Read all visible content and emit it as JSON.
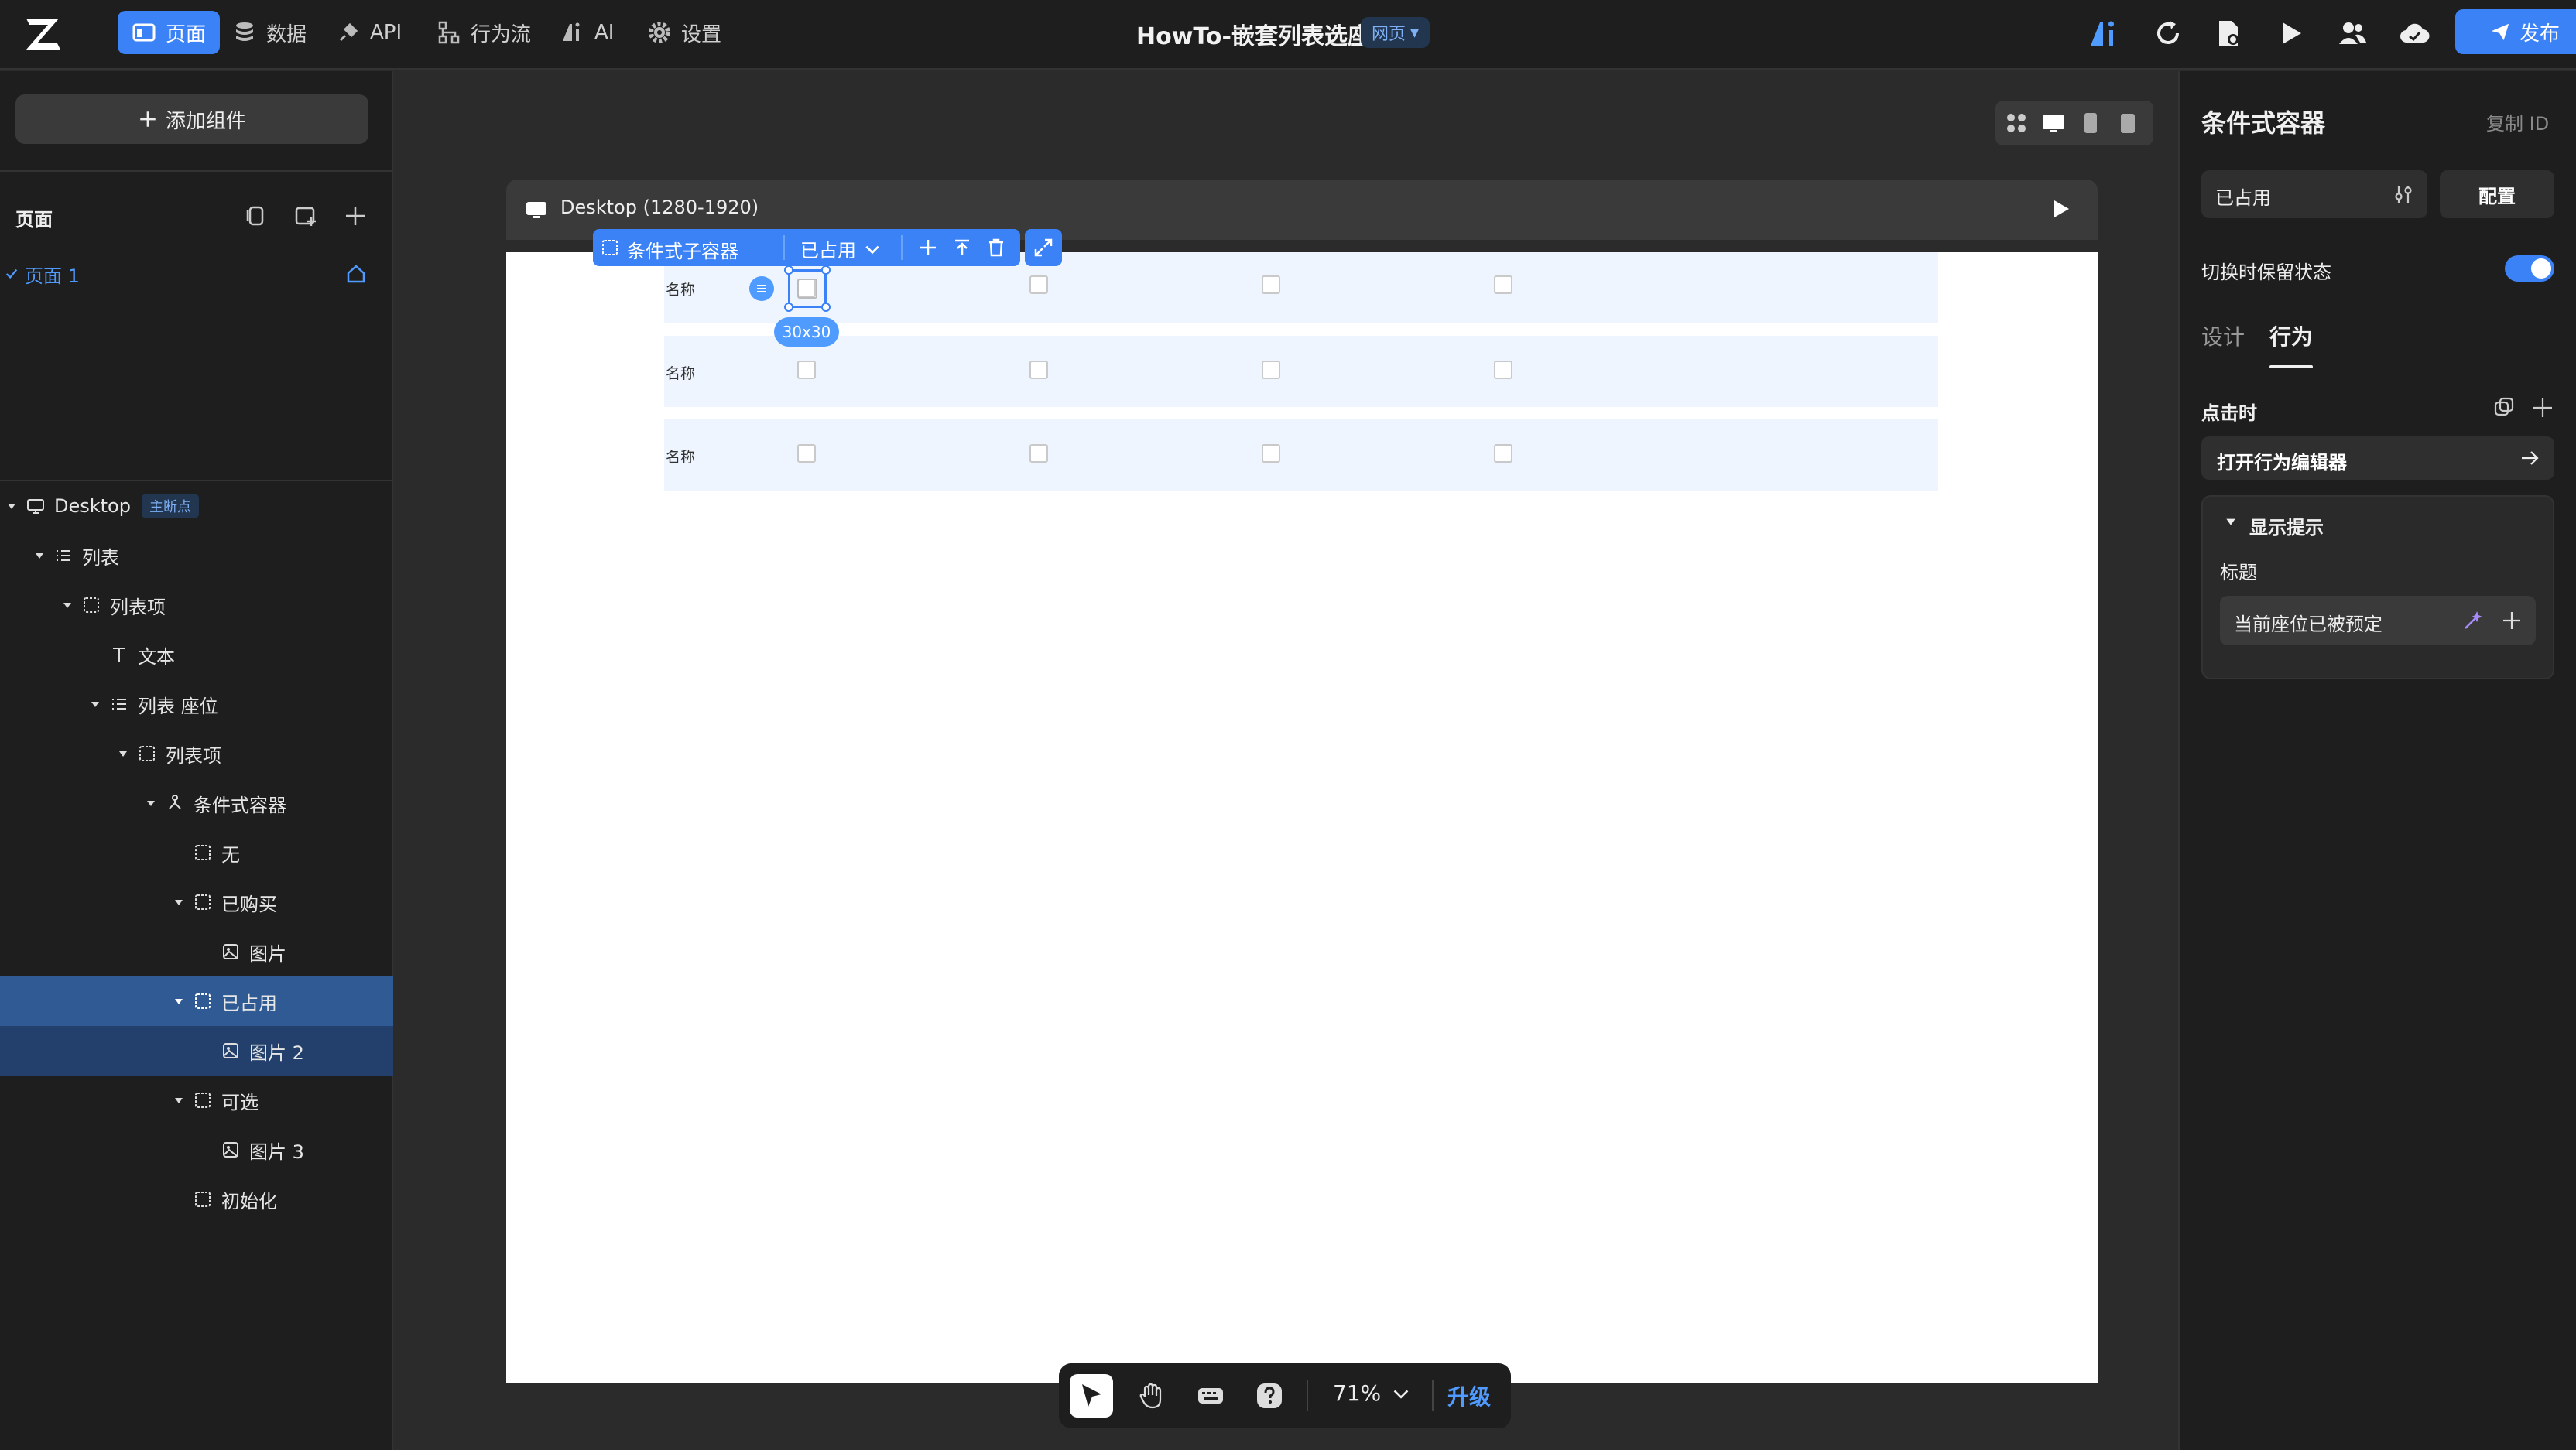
{
  "topbar": {
    "nav": [
      {
        "label": "页面",
        "icon": "page-icon"
      },
      {
        "label": "数据",
        "icon": "database-icon"
      },
      {
        "label": "API",
        "icon": "plug-icon"
      },
      {
        "label": "行为流",
        "icon": "flow-icon"
      },
      {
        "label": "AI",
        "icon": "ai-icon"
      },
      {
        "label": "设置",
        "icon": "gear-icon"
      }
    ],
    "doc_title": "HowTo-嵌套列表选座",
    "mode_badge": "网页",
    "publish_label": "发布",
    "accent": "#3b82f6"
  },
  "left": {
    "add_component": "添加组件",
    "pages_title": "页面",
    "page_item": "页面 1",
    "tree": [
      {
        "label": "Desktop",
        "badge": "主断点"
      },
      {
        "label": "列表"
      },
      {
        "label": "列表项"
      },
      {
        "label": "文本"
      },
      {
        "label": "列表 座位"
      },
      {
        "label": "列表项"
      },
      {
        "label": "条件式容器"
      },
      {
        "label": "无"
      },
      {
        "label": "已购买"
      },
      {
        "label": "图片"
      },
      {
        "label": "已占用"
      },
      {
        "label": "图片 2"
      },
      {
        "label": "可选"
      },
      {
        "label": "图片 3"
      },
      {
        "label": "初始化"
      }
    ]
  },
  "canvas": {
    "frame_label": "Desktop (1280-1920)",
    "toolbar_component": "条件式子容器",
    "toolbar_state": "已占用",
    "size_tip": "30x30",
    "row_labels": [
      "名称",
      "名称",
      "名称"
    ],
    "zoom": "71%",
    "upgrade": "升级"
  },
  "right": {
    "title": "条件式容器",
    "copy_id": "复制 ID",
    "state_value": "已占用",
    "config_label": "配置",
    "keep_state_label": "切换时保留状态",
    "keep_state_on": true,
    "tabs": [
      "设计",
      "行为"
    ],
    "active_tab": "行为",
    "on_click_label": "点击时",
    "open_editor_label": "打开行为编辑器",
    "action_title": "显示提示",
    "field_label": "标题",
    "field_value": "当前座位已被预定"
  }
}
